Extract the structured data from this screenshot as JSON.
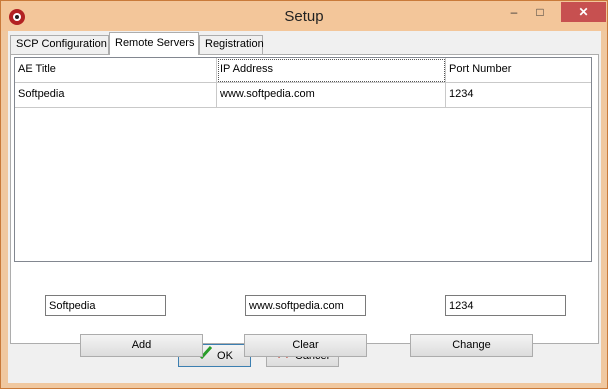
{
  "window": {
    "title": "Setup",
    "minimize": "–",
    "maximize": "□",
    "close": "✕"
  },
  "tabs": [
    {
      "label": "SCP Configuration",
      "active": false
    },
    {
      "label": "Remote Servers",
      "active": true
    },
    {
      "label": "Registration",
      "active": false
    }
  ],
  "table": {
    "columns": [
      "AE Title",
      "IP Address",
      "Port Number"
    ],
    "rows": [
      [
        "Softpedia",
        "www.softpedia.com",
        "1234"
      ]
    ]
  },
  "inputs": {
    "ae_title": "Softpedia",
    "ip_address": "www.softpedia.com",
    "port_number": "1234"
  },
  "buttons": {
    "add": "Add",
    "clear": "Clear",
    "change": "Change",
    "ok": "OK",
    "cancel": "Cancel"
  },
  "icons": {
    "app": "app-logo-icon",
    "ok": "checkmark-icon",
    "cancel": "x-mark-icon"
  },
  "colors": {
    "titlebar": "#f3c69a",
    "close": "#c75050",
    "ok_check": "#2a9d2a",
    "cancel_x": "#c0392b"
  }
}
